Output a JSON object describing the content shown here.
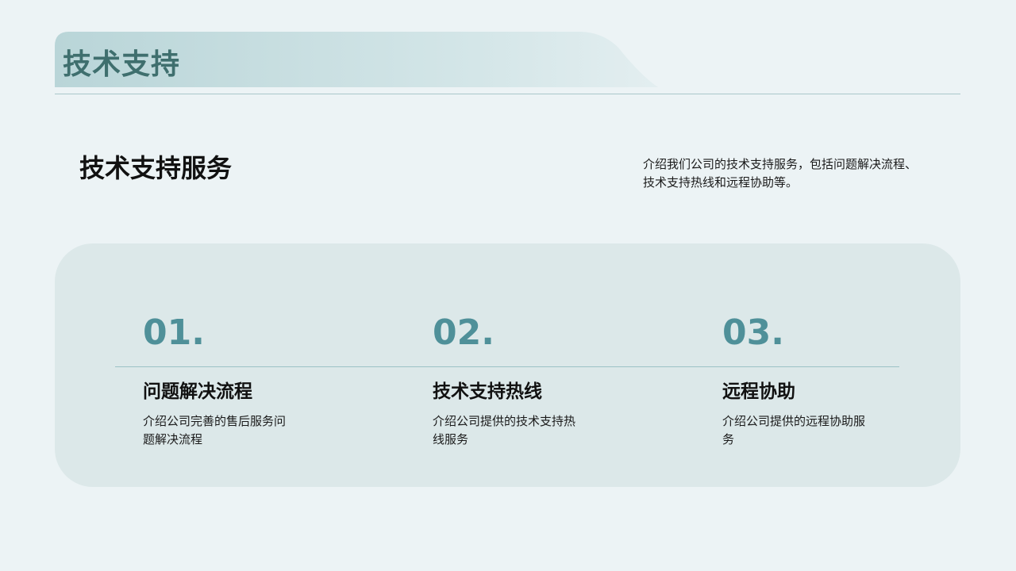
{
  "header": {
    "title": "技术支持"
  },
  "intro": {
    "title": "技术支持服务",
    "description": "介绍我们公司的技术支持服务，包括问题解决流程、技术支持热线和远程协助等。"
  },
  "steps": [
    {
      "number": "01.",
      "title": "问题解决流程",
      "description": "介绍公司完善的售后服务问题解决流程"
    },
    {
      "number": "02.",
      "title": "技术支持热线",
      "description": "介绍公司提供的技术支持热线服务"
    },
    {
      "number": "03.",
      "title": "远程协助",
      "description": "介绍公司提供的远程协助服务"
    }
  ],
  "colors": {
    "background": "#ecf3f5",
    "header_band": "#b8d6d9",
    "header_text": "#3f6f6e",
    "card": "#dce8e9",
    "accent_number": "#4f9099",
    "divider": "#a9c7cb"
  }
}
